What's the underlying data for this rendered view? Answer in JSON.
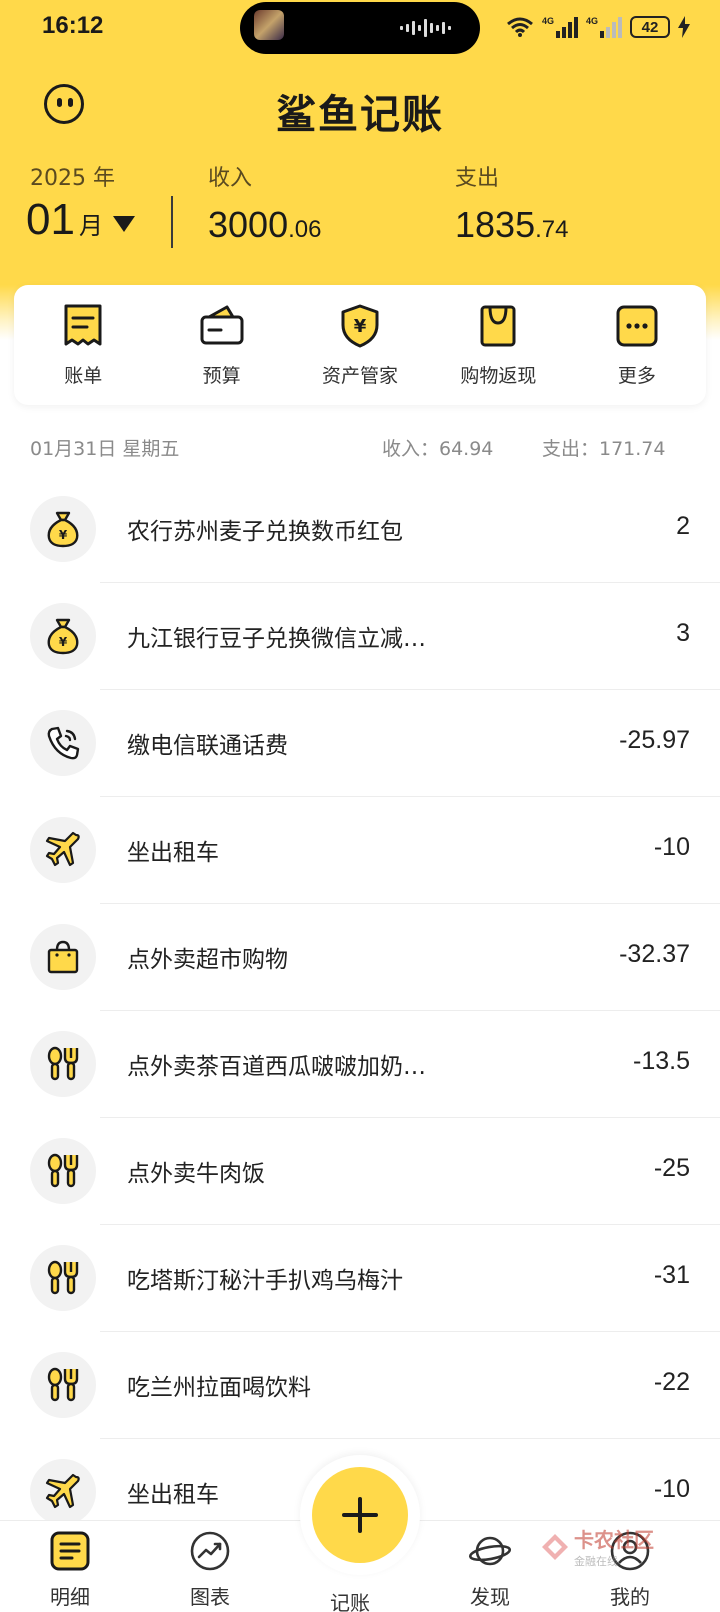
{
  "status_bar": {
    "time": "16:12",
    "battery": "42",
    "signal_1": "4G",
    "signal_2": "4G"
  },
  "header": {
    "app_title": "鲨鱼记账",
    "year": "2025 年",
    "month_num": "01",
    "month_unit": "月",
    "income_label": "收入",
    "income_int": "3000",
    "income_dec": ".06",
    "expense_label": "支出",
    "expense_int": "1835",
    "expense_dec": ".74"
  },
  "quick_actions": [
    {
      "label": "账单",
      "icon": "bill-icon"
    },
    {
      "label": "预算",
      "icon": "wallet-icon"
    },
    {
      "label": "资产管家",
      "icon": "shield-yen-icon"
    },
    {
      "label": "购物返现",
      "icon": "shopping-bag-icon"
    },
    {
      "label": "更多",
      "icon": "more-icon"
    }
  ],
  "day": {
    "date": "01月31日 星期五",
    "income": "收入：64.94",
    "expense": "支出：171.74"
  },
  "transactions": [
    {
      "icon": "money-bag-icon",
      "name": "农行苏州麦子兑换数币红包",
      "amount": "2"
    },
    {
      "icon": "money-bag-icon",
      "name": "九江银行豆子兑换微信立减…",
      "amount": "3"
    },
    {
      "icon": "phone-icon",
      "name": "缴电信联通话费",
      "amount": "-25.97"
    },
    {
      "icon": "airplane-icon",
      "name": "坐出租车",
      "amount": "-10"
    },
    {
      "icon": "shopping-bag-icon",
      "name": "点外卖超市购物",
      "amount": "-32.37"
    },
    {
      "icon": "dining-icon",
      "name": "点外卖茶百道西瓜啵啵加奶…",
      "amount": "-13.5"
    },
    {
      "icon": "dining-icon",
      "name": "点外卖牛肉饭",
      "amount": "-25"
    },
    {
      "icon": "dining-icon",
      "name": "吃塔斯汀秘汁手扒鸡乌梅汁",
      "amount": "-31"
    },
    {
      "icon": "dining-icon",
      "name": "吃兰州拉面喝饮料",
      "amount": "-22"
    },
    {
      "icon": "airplane-icon",
      "name": "坐出租车",
      "amount": "-10"
    }
  ],
  "bottom_nav": [
    {
      "label": "明细",
      "icon": "list-icon"
    },
    {
      "label": "图表",
      "icon": "chart-icon"
    },
    {
      "label": "记账",
      "icon": "plus-icon"
    },
    {
      "label": "发现",
      "icon": "planet-icon"
    },
    {
      "label": "我的",
      "icon": "user-icon"
    }
  ],
  "watermark": {
    "main": "卡农社区",
    "sub": "金融在线"
  },
  "colors": {
    "accent": "#FFD94A",
    "icon_fill": "#FFD94A",
    "text_dark": "#1a1a1a",
    "text_gray": "#8a8a8a"
  }
}
